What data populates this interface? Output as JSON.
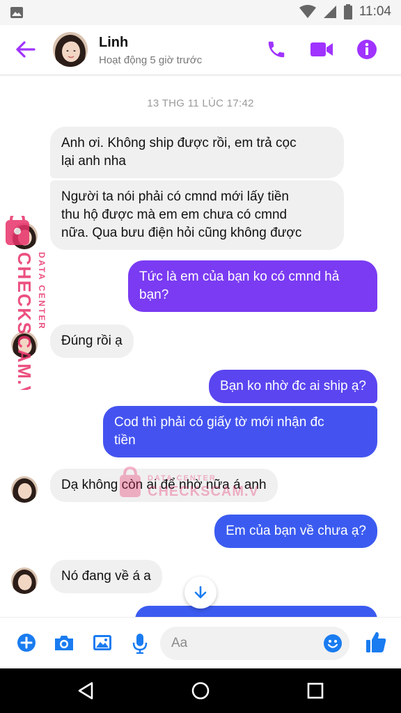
{
  "status_bar": {
    "time": "11:04"
  },
  "header": {
    "contact_name": "Linh",
    "activity_status": "Hoạt động 5 giờ trước"
  },
  "conversation": {
    "timestamp": "13 THG 11 LÚC 17:42",
    "messages": [
      {
        "from": "contact",
        "text_lines": [
          "Anh ơi. Không ship được rồi, em trả cọc",
          "lại anh nha"
        ]
      },
      {
        "from": "contact",
        "text_lines": [
          "Người ta nói phải có cmnd mới lấy tiền",
          "thu hộ được mà em em chưa có cmnd",
          "nữa. Qua bưu điện hỏi cũng không được"
        ]
      },
      {
        "from": "me",
        "text_lines": [
          "Tức là em của bạn ko có cmnd hả",
          "bạn?"
        ]
      },
      {
        "from": "contact",
        "text_lines": [
          "Đúng rồi ạ"
        ]
      },
      {
        "from": "me",
        "text_lines": [
          "Bạn ko nhờ đc ai ship ạ?"
        ]
      },
      {
        "from": "me",
        "text_lines": [
          "Cod thì phải có giấy tờ mới nhận đc",
          "tiền"
        ]
      },
      {
        "from": "contact",
        "text_lines": [
          "Dạ không còn ai để nhờ nữa á anh"
        ]
      },
      {
        "from": "me",
        "text_lines": [
          "Em của bạn về chưa ạ?"
        ]
      },
      {
        "from": "contact",
        "text_lines": [
          "Nó đang về á a"
        ]
      }
    ]
  },
  "watermark": {
    "line1": "DATA CENTER",
    "line2": "CHECKSCAM.VN"
  },
  "composer": {
    "placeholder": "Aa"
  },
  "colors": {
    "accent": "#a033ff",
    "incoming_bubble": "#f0f0f0",
    "outgoing_purple": "#7a3bf2",
    "outgoing_blue": "#3b5bf0",
    "icon_blue": "#1a7cf0",
    "watermark": "#e8336b"
  }
}
